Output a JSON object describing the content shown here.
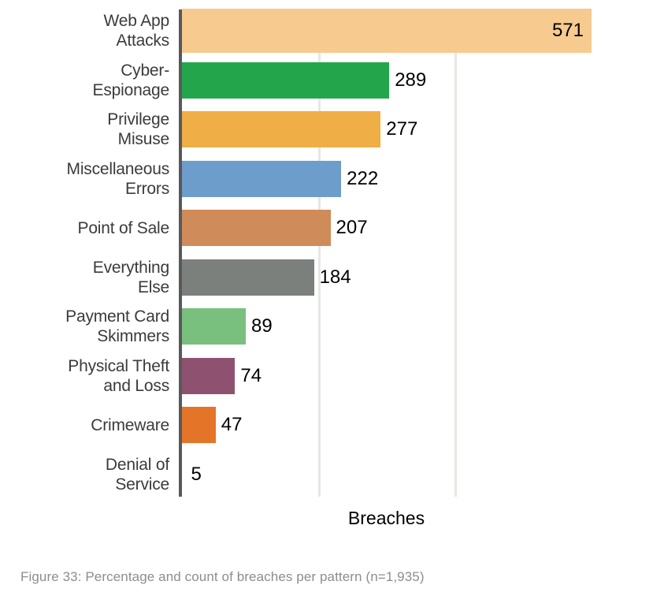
{
  "chart_data": {
    "type": "bar",
    "orientation": "horizontal",
    "title": "",
    "xlabel": "Breaches",
    "ylabel": "",
    "xlim": [
      0,
      600
    ],
    "grid": true,
    "gridlines": [
      200,
      400
    ],
    "legend": "none",
    "categories": [
      "Web App\nAttacks",
      "Cyber-\nEspionage",
      "Privilege\nMisuse",
      "Miscellaneous\nErrors",
      "Point of Sale",
      "Everything\nElse",
      "Payment Card\nSkimmers",
      "Physical Theft\nand Loss",
      "Crimeware",
      "Denial of\nService"
    ],
    "values": [
      571,
      289,
      277,
      222,
      207,
      184,
      89,
      74,
      47,
      5
    ],
    "value_labels": [
      "571",
      "289",
      "277",
      "222",
      "207",
      "184",
      "89",
      "74",
      "47",
      "5"
    ],
    "colors": [
      "#f7ca8f",
      "#23a64b",
      "#f0ae46",
      "#6d9dcb",
      "#d08b5a",
      "#7c807d",
      "#79bf7e",
      "#8e5270",
      "#e47427",
      "#ffffff"
    ],
    "label_placement": [
      "inside",
      "outside",
      "outside",
      "outside",
      "outside",
      "outside",
      "outside",
      "outside",
      "outside",
      "outside"
    ]
  },
  "axis": {
    "x_title": "Breaches",
    "axis_color": "#58595b",
    "grid_color": "#e9e7e4"
  },
  "caption": {
    "text": "Figure 33: Percentage and count of breaches per pattern (n=1,935)",
    "color": "#8d8d8d"
  }
}
